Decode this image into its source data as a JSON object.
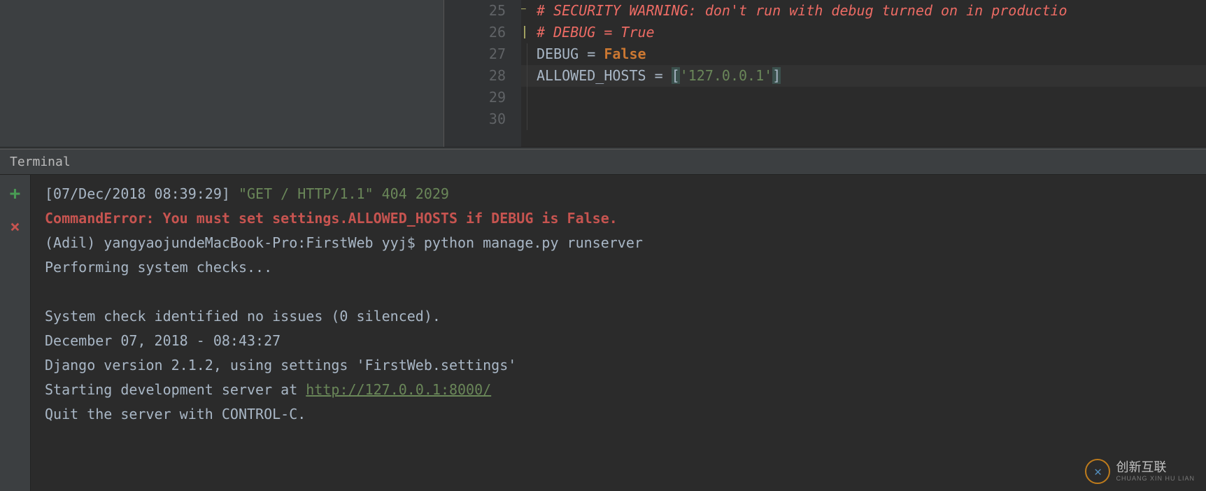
{
  "editor": {
    "gutter": [
      "25",
      "26",
      "27",
      "28",
      "29",
      "30"
    ],
    "lines": {
      "l25": "# SECURITY WARNING: don't run with debug turned on in productio",
      "l26": "# DEBUG = True",
      "l27_ident": "DEBUG",
      "l27_eq": " = ",
      "l27_val": "False",
      "l28_ident": "ALLOWED_HOSTS",
      "l28_eq": " = ",
      "l28_lb": "[",
      "l28_str": "'127.0.0.1'",
      "l28_rb": "]"
    }
  },
  "terminal": {
    "tab_label": "Terminal",
    "output": {
      "ts": "[07/Dec/2018 08:39:29]",
      "req": " \"GET / HTTP/1.1\" 404 2029",
      "err": "CommandError: You must set settings.ALLOWED_HOSTS if DEBUG is False.",
      "prompt": "(Adil) yangyaojundeMacBook-Pro:FirstWeb yyj$ python manage.py runserver",
      "checks": "Performing system checks...",
      "blank": "",
      "noissues": "System check identified no issues (0 silenced).",
      "date": "December 07, 2018 - 08:43:27",
      "version": "Django version 2.1.2, using settings 'FirstWeb.settings'",
      "starting_pre": "Starting development server at ",
      "starting_link": "http://127.0.0.1:8000/",
      "quit": "Quit the server with CONTROL-C."
    }
  },
  "watermark": {
    "logo": "✕",
    "text": "创新互联",
    "sub": "CHUANG XIN HU LIAN"
  }
}
